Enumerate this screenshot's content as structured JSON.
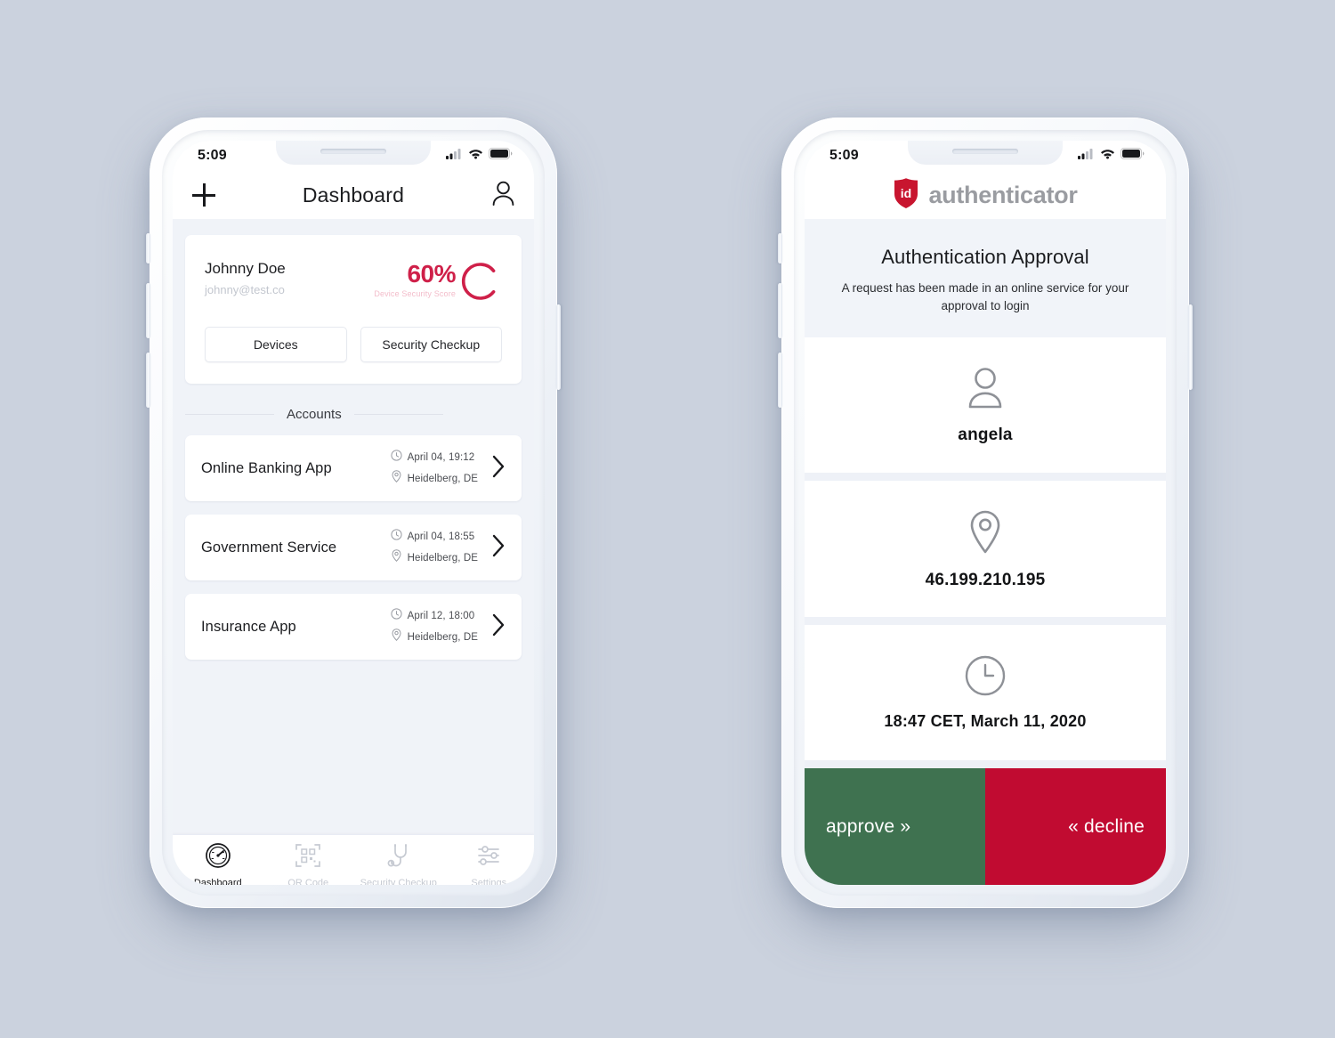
{
  "canvas": {
    "background": "#cbd2de"
  },
  "phone1": {
    "status": {
      "time": "5:09",
      "icons": [
        "signal-icon",
        "wifi-icon",
        "battery-icon"
      ]
    },
    "navbar": {
      "add_icon": "plus-icon",
      "title": "Dashboard",
      "profile_icon": "person-icon"
    },
    "profile_card": {
      "name": "Johnny Doe",
      "email": "johnny@test.co",
      "score_value": "60%",
      "score_label": "Device Security Score",
      "score_percent": 60,
      "score_color": "#cf2049",
      "buttons": [
        {
          "label": "Devices",
          "name": "devices-button"
        },
        {
          "label": "Security Checkup",
          "name": "security-checkup-button"
        }
      ]
    },
    "accounts_section": {
      "title": "Accounts"
    },
    "accounts": [
      {
        "name": "Online Banking App",
        "time": "April 04, 19:12",
        "location": "Heidelberg, DE"
      },
      {
        "name": "Government Service",
        "time": "April 04, 18:55",
        "location": "Heidelberg, DE"
      },
      {
        "name": "Insurance App",
        "time": "April 12, 18:00",
        "location": "Heidelberg, DE"
      }
    ],
    "tabs": [
      {
        "label": "Dashboard",
        "icon": "speedometer-icon",
        "active": true
      },
      {
        "label": "QR Code",
        "icon": "qr-code-icon",
        "active": false
      },
      {
        "label": "Security Checkup",
        "icon": "stethoscope-icon",
        "active": false
      },
      {
        "label": "Settings",
        "icon": "sliders-icon",
        "active": false
      }
    ]
  },
  "phone2": {
    "status": {
      "time": "5:09",
      "icons": [
        "signal-icon",
        "wifi-icon",
        "battery-icon"
      ]
    },
    "brand": {
      "logo_text": "id",
      "logo_icon": "shield-icon",
      "name": "authenticator",
      "logo_color": "#c8152f"
    },
    "intro": {
      "title": "Authentication Approval",
      "subtitle": "A request has been made in an online service for your approval to login"
    },
    "details": [
      {
        "icon": "person-icon",
        "value": "angela",
        "name": "username"
      },
      {
        "icon": "location-pin-icon",
        "value": "46.199.210.195",
        "name": "ip-address"
      },
      {
        "icon": "clock-icon",
        "value": "18:47 CET, March 11, 2020",
        "name": "timestamp"
      }
    ],
    "decision": {
      "approve_label": "approve »",
      "decline_label": "« decline",
      "approve_color": "#3f7250",
      "decline_color": "#c10b31"
    }
  }
}
